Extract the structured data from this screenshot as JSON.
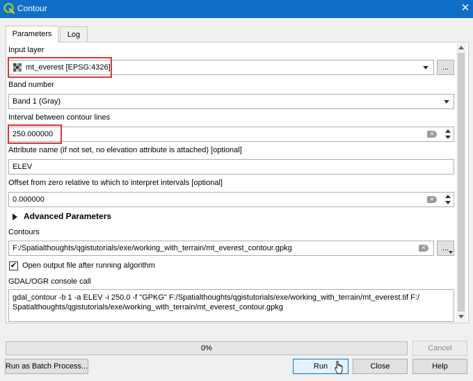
{
  "window": {
    "title": "Contour"
  },
  "tabs": [
    {
      "label": "Parameters"
    },
    {
      "label": "Log"
    }
  ],
  "input_layer": {
    "label": "Input layer",
    "value": "mt_everest [EPSG:4326]",
    "browse_label": "..."
  },
  "band_number": {
    "label": "Band number",
    "value": "Band 1 (Gray)"
  },
  "interval": {
    "label": "Interval between contour lines",
    "value": "250.000000"
  },
  "attribute": {
    "label": "Attribute name (if not set, no elevation attribute is attached) [optional]",
    "value": "ELEV"
  },
  "offset": {
    "label": "Offset from zero relative to which to interpret intervals [optional]",
    "value": "0.000000"
  },
  "advanced": {
    "label": "Advanced Parameters"
  },
  "contours": {
    "label": "Contours",
    "value": "F:/Spatialthoughts/qgistutorials/exe/working_with_terrain/mt_everest_contour.gpkg",
    "browse_label": "..."
  },
  "open_output": {
    "label": "Open output file after running algorithm",
    "checked": true
  },
  "console": {
    "label": "GDAL/OGR console call",
    "line1": "gdal_contour -b 1 -a ELEV -i 250.0 -f \"GPKG\" F:/Spatialthoughts/qgistutorials/exe/working_with_terrain/mt_everest.tif F:/",
    "line2": "Spatialthoughts/qgistutorials/exe/working_with_terrain/mt_everest_contour.gpkg"
  },
  "progress": {
    "value": 0,
    "text": "0%"
  },
  "buttons": {
    "cancel": "Cancel",
    "batch": "Run as Batch Process...",
    "run": "Run",
    "close": "Close",
    "help": "Help"
  },
  "colors": {
    "titlebar": "#0f6fc6",
    "highlight": "#e03232"
  },
  "icons": {
    "app": "qgis-logo-icon",
    "close": "close-icon",
    "layer": "raster-layer-icon",
    "cursor": "mouse-cursor-icon"
  }
}
